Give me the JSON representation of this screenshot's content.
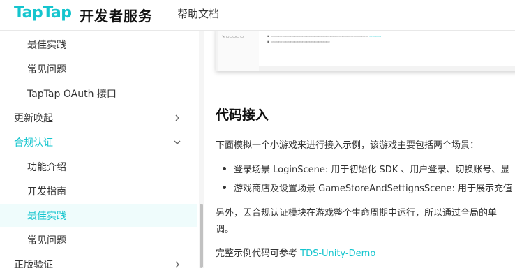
{
  "header": {
    "logo_text": "TapTap",
    "logo_subtitle": "开发者服务",
    "nav_link": "帮助文档"
  },
  "sidebar": {
    "items": [
      {
        "label": "最佳实践",
        "level": 2
      },
      {
        "label": "常见问题",
        "level": 2
      },
      {
        "label": "TapTap OAuth 接口",
        "level": 2
      },
      {
        "label": "更新唤起",
        "level": 1,
        "chevron": "right"
      },
      {
        "label": "合规认证",
        "level": 1,
        "chevron": "down",
        "expanded": true
      },
      {
        "label": "功能介绍",
        "level": 2
      },
      {
        "label": "开发指南",
        "level": 2
      },
      {
        "label": "最佳实践",
        "level": 2,
        "selected": true
      },
      {
        "label": "常见问题",
        "level": 2
      },
      {
        "label": "正版验证",
        "level": 1,
        "chevron": "right"
      }
    ],
    "accent_color": "#15c5ce"
  },
  "main": {
    "section_title": "代码接入",
    "intro": "下面模拟一个小游戏来进行接入示例，该游戏主要包括两个场景：",
    "bullets": [
      "登录场景 LoginScene: 用于初始化 SDK 、用户登录、切换账号、显",
      "游戏商店及设置场景 GameStoreAndSettignsScene: 用于展示充值"
    ],
    "note_line1": "另外，因合规认证模块在游戏整个生命周期中运行，所以通过全局的单",
    "note_line2": "调。",
    "demo_prefix": "完整示例代码可参考 ",
    "demo_link": "TDS-Unity-Demo"
  }
}
